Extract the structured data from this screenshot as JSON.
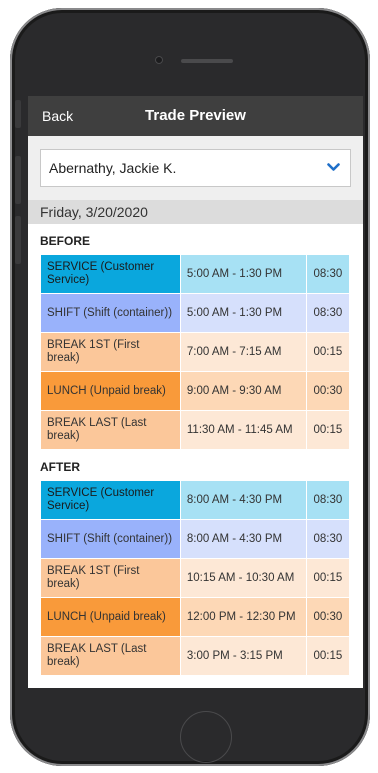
{
  "header": {
    "back_label": "Back",
    "title": "Trade Preview"
  },
  "employee": {
    "selected": "Abernathy, Jackie K."
  },
  "date": "Friday, 3/20/2020",
  "sections": [
    {
      "label": "BEFORE",
      "rows": [
        {
          "type": "service",
          "label": "SERVICE (Customer Service)",
          "time": "5:00 AM - 1:30 PM",
          "duration": "08:30"
        },
        {
          "type": "shift",
          "label": "SHIFT (Shift (container))",
          "time": "5:00 AM - 1:30 PM",
          "duration": "08:30"
        },
        {
          "type": "break",
          "label": "BREAK 1ST (First break)",
          "time": "7:00 AM - 7:15 AM",
          "duration": "00:15"
        },
        {
          "type": "lunch",
          "label": "LUNCH (Unpaid break)",
          "time": "9:00 AM - 9:30 AM",
          "duration": "00:30"
        },
        {
          "type": "break",
          "label": "BREAK LAST (Last break)",
          "time": "11:30 AM - 11:45 AM",
          "duration": "00:15"
        }
      ]
    },
    {
      "label": "AFTER",
      "rows": [
        {
          "type": "service",
          "label": "SERVICE (Customer Service)",
          "time": "8:00 AM - 4:30 PM",
          "duration": "08:30"
        },
        {
          "type": "shift",
          "label": "SHIFT (Shift (container))",
          "time": "8:00 AM - 4:30 PM",
          "duration": "08:30"
        },
        {
          "type": "break",
          "label": "BREAK 1ST (First break)",
          "time": "10:15 AM - 10:30 AM",
          "duration": "00:15"
        },
        {
          "type": "lunch",
          "label": "LUNCH (Unpaid break)",
          "time": "12:00 PM - 12:30 PM",
          "duration": "00:30"
        },
        {
          "type": "break",
          "label": "BREAK LAST (Last break)",
          "time": "3:00 PM - 3:15 PM",
          "duration": "00:15"
        }
      ]
    }
  ],
  "colors": {
    "navbar": "#3f3f3f",
    "service": "#0aa7dd",
    "shift": "#99b2fb",
    "break": "#fbc79a",
    "lunch": "#f99a3a",
    "chevron": "#1f6fc9"
  },
  "icons": {
    "dropdown": "chevron-down-icon"
  }
}
